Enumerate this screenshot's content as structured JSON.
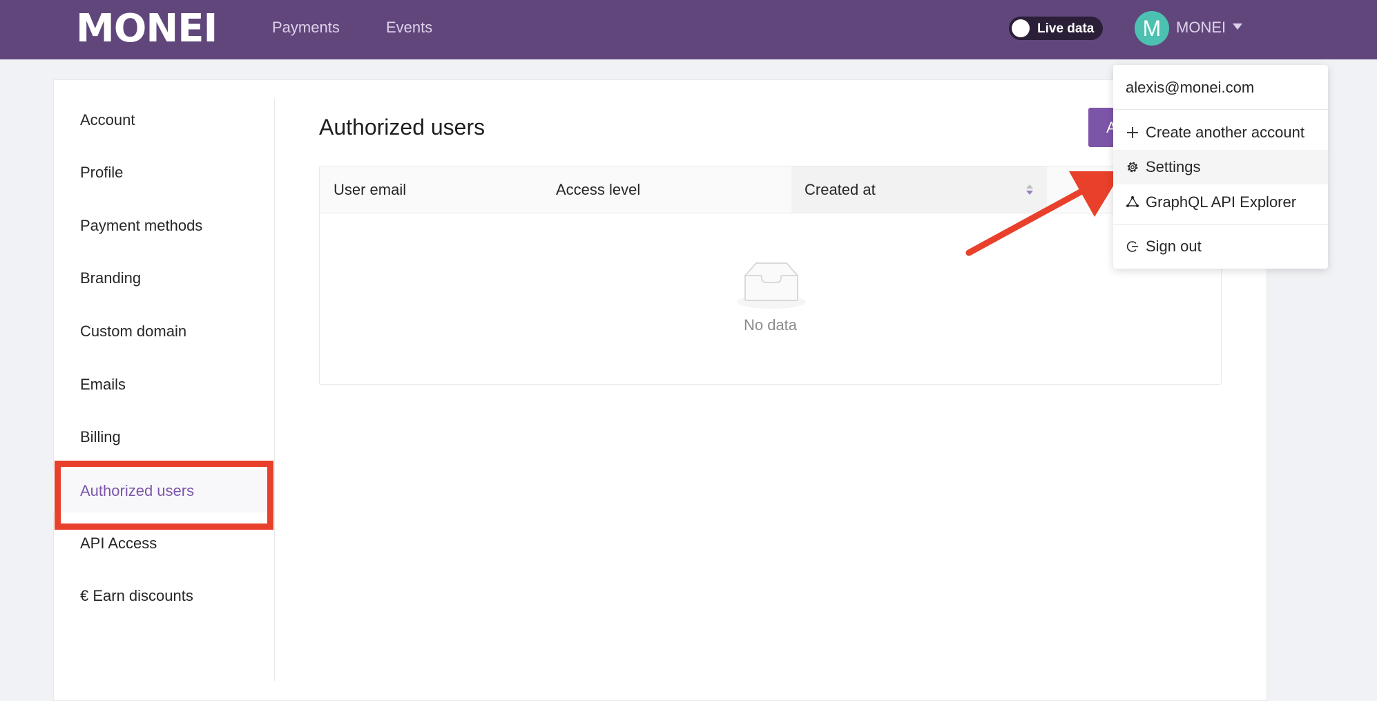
{
  "header": {
    "logo": "MONEI",
    "nav": [
      "Payments",
      "Events"
    ],
    "live_toggle_label": "Live data",
    "avatar_initial": "M",
    "account_name": "MONEI"
  },
  "sidebar": {
    "items": [
      {
        "label": "Account"
      },
      {
        "label": "Profile"
      },
      {
        "label": "Payment methods"
      },
      {
        "label": "Branding"
      },
      {
        "label": "Custom domain"
      },
      {
        "label": "Emails"
      },
      {
        "label": "Billing"
      },
      {
        "label": "Authorized users"
      },
      {
        "label": "API Access"
      },
      {
        "label": "€ Earn discounts"
      }
    ],
    "active": "Authorized users"
  },
  "main": {
    "title": "Authorized users",
    "add_button_label": "A",
    "table": {
      "columns": [
        "User email",
        "Access level",
        "Created at"
      ],
      "empty_text": "No data"
    }
  },
  "account_menu": {
    "email": "alexis@monei.com",
    "items": [
      {
        "label": "Create another account",
        "icon": "plus-icon"
      },
      {
        "label": "Settings",
        "icon": "gear-icon"
      },
      {
        "label": "GraphQL API Explorer",
        "icon": "graphql-icon"
      },
      {
        "label": "Sign out",
        "icon": "sign-out-icon"
      }
    ]
  },
  "colors": {
    "header_bg": "#61467c",
    "accent": "#7d55a8",
    "annotation": "#e8402a",
    "avatar": "#4dc1b1"
  }
}
